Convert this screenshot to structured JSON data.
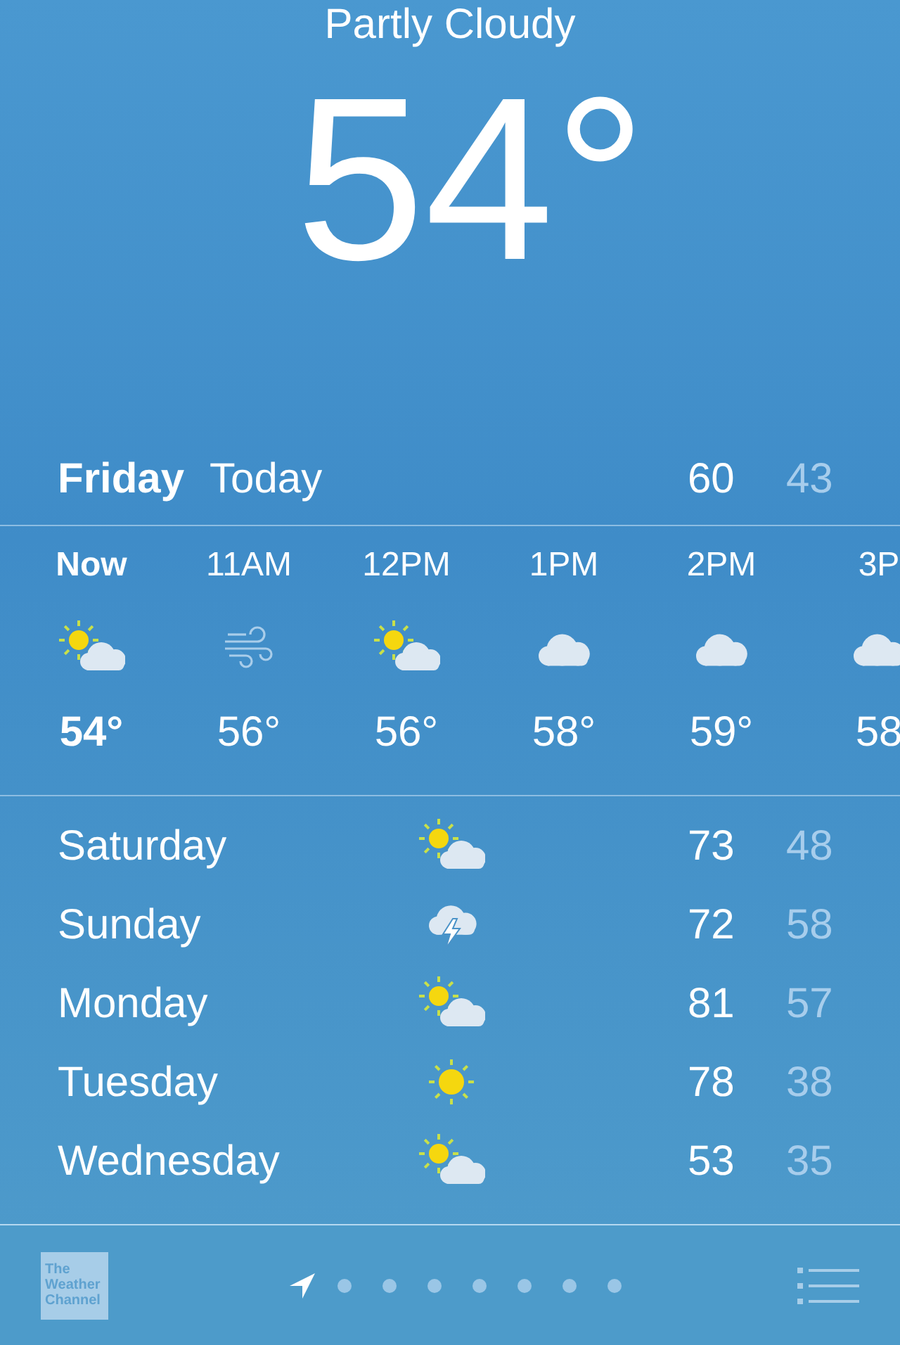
{
  "condition": "Partly Cloudy",
  "temperature": "54°",
  "today": {
    "day": "Friday",
    "label": "Today",
    "high": "60",
    "low": "43"
  },
  "hours": [
    {
      "time": "Now",
      "kind": "partly_cloudy",
      "temp": "54°",
      "current": true
    },
    {
      "time": "11AM",
      "kind": "wind",
      "temp": "56°",
      "current": false
    },
    {
      "time": "12PM",
      "kind": "partly_cloudy",
      "temp": "56°",
      "current": false
    },
    {
      "time": "1PM",
      "kind": "cloudy",
      "temp": "58°",
      "current": false
    },
    {
      "time": "2PM",
      "kind": "cloudy",
      "temp": "59°",
      "current": false
    },
    {
      "time": "3P",
      "kind": "cloudy",
      "temp": "58",
      "current": false
    }
  ],
  "days": [
    {
      "day": "Saturday",
      "kind": "partly_cloudy",
      "high": "73",
      "low": "48"
    },
    {
      "day": "Sunday",
      "kind": "thunderstorm",
      "high": "72",
      "low": "58"
    },
    {
      "day": "Monday",
      "kind": "partly_cloudy",
      "high": "81",
      "low": "57"
    },
    {
      "day": "Tuesday",
      "kind": "sunny",
      "high": "78",
      "low": "38"
    },
    {
      "day": "Wednesday",
      "kind": "partly_cloudy",
      "high": "53",
      "low": "35"
    }
  ],
  "logo": [
    "The",
    "Weather",
    "Channel"
  ],
  "pages": [
    {
      "kind": "location",
      "selected": true
    },
    {
      "kind": "dot",
      "selected": false
    },
    {
      "kind": "dot",
      "selected": false
    },
    {
      "kind": "dot",
      "selected": false
    },
    {
      "kind": "dot",
      "selected": false
    },
    {
      "kind": "dot",
      "selected": false
    },
    {
      "kind": "dot",
      "selected": false
    },
    {
      "kind": "dot",
      "selected": false
    }
  ]
}
